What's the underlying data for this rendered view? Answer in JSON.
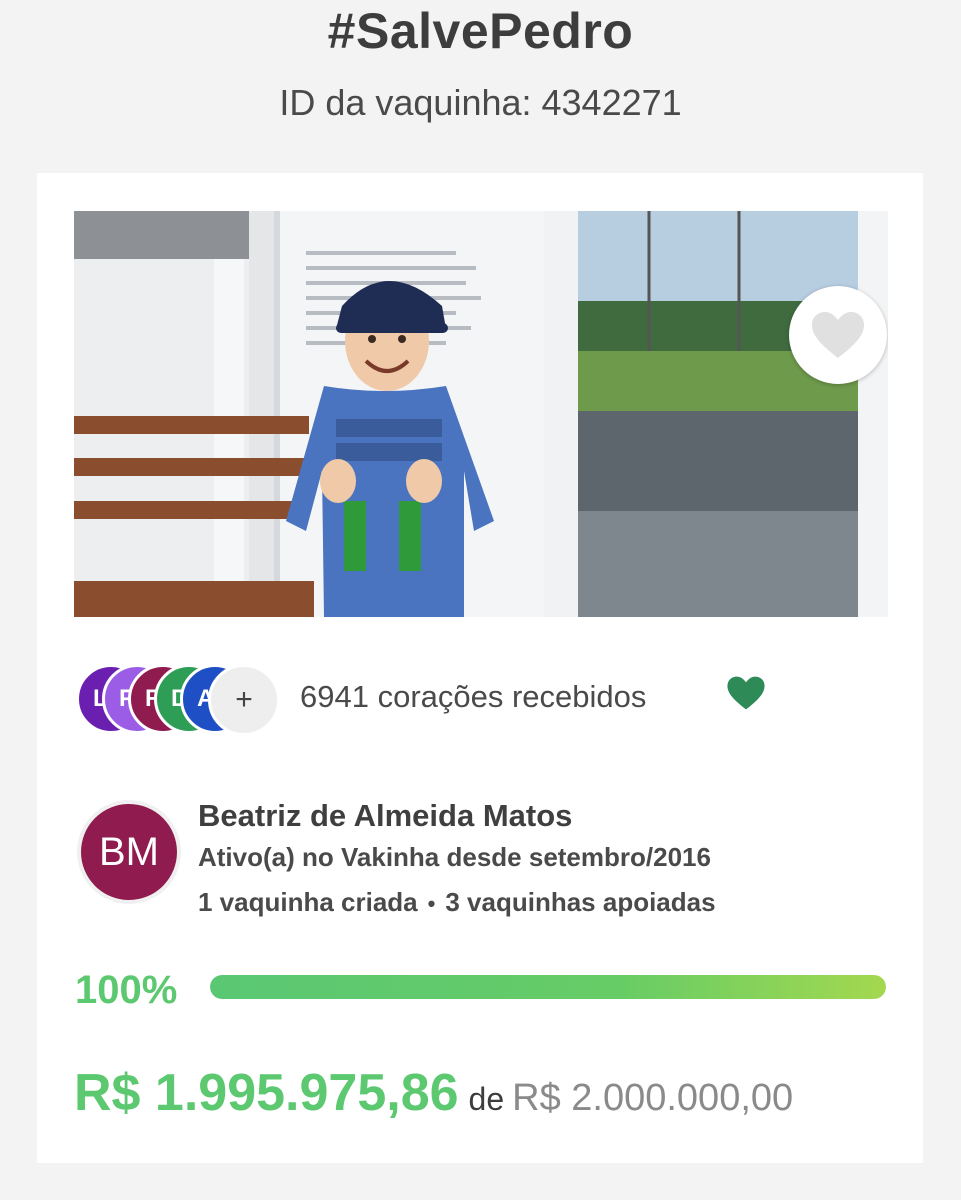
{
  "page": {
    "title": "#SalvePedro",
    "subtitle": "ID da vaquinha: 4342271"
  },
  "photo": {
    "description_icon": "campaign-photo",
    "favorite_icon": "heart-icon"
  },
  "hearts": {
    "supporters": [
      {
        "initial": "L",
        "color": "#6a1fb0"
      },
      {
        "initial": "P",
        "color": "#9b5de5"
      },
      {
        "initial": "R",
        "color": "#8f1b4f"
      },
      {
        "initial": "D",
        "color": "#2e9e57"
      },
      {
        "initial": "A",
        "color": "#1f4fc4"
      }
    ],
    "more_label": "+",
    "count_text": "6941 corações recebidos",
    "heart_color": "#2e8b57"
  },
  "author": {
    "initials": "BM",
    "avatar_color": "#8f1b4f",
    "name": "Beatriz de Almeida Matos",
    "since": "Ativo(a) no Vakinha desde setembro/2016",
    "created": "1 vaquinha criada",
    "separator": "•",
    "supported": "3 vaquinhas apoiadas"
  },
  "progress": {
    "percent_label": "100%",
    "fill_fraction": 1.0,
    "color": "#5cc86f"
  },
  "amount": {
    "raised": "R$ 1.995.975,86",
    "of_label": "de",
    "goal": "R$ 2.000.000,00"
  }
}
